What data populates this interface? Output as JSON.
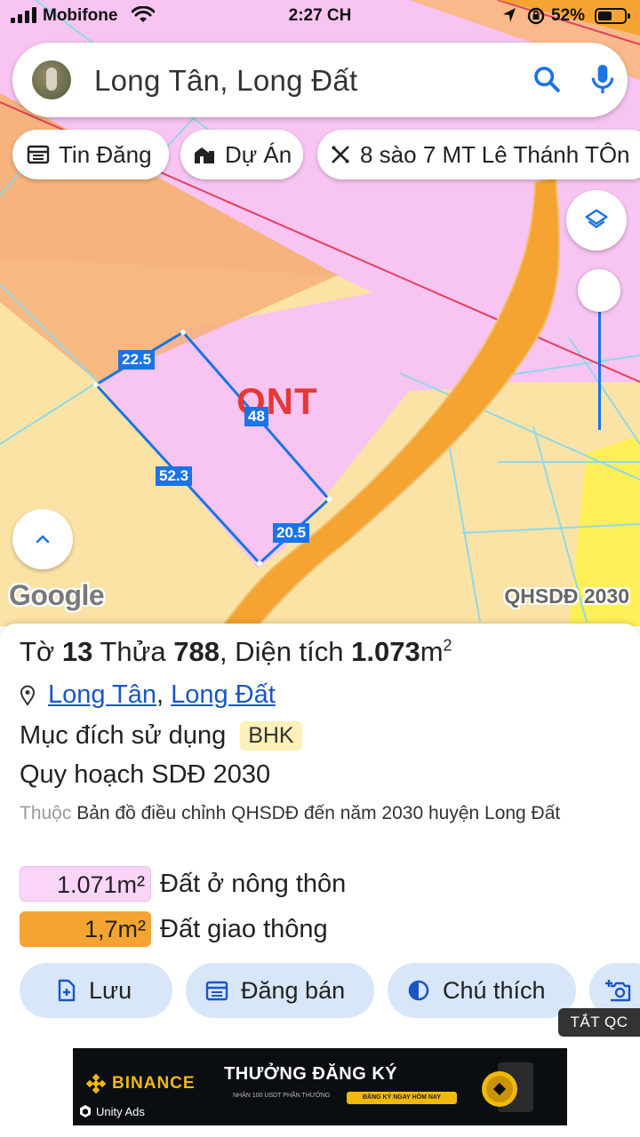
{
  "status_bar": {
    "carrier": "Mobifone",
    "time": "2:27 CH",
    "battery_percent": "52%",
    "battery_level": 0.52
  },
  "search": {
    "query": "Long Tân, Long Đất"
  },
  "chips": [
    {
      "label": "Tin Đăng",
      "icon": "newspaper-icon"
    },
    {
      "label": "Dự Án",
      "icon": "buildings-icon"
    },
    {
      "label": "8 sào 7 MT Lê Thánh TÔn",
      "icon": "pencil-ruler-icon"
    }
  ],
  "map": {
    "zone_label": "ONT",
    "dimensions": [
      "22.5",
      "48",
      "52.3",
      "20.5"
    ],
    "attribution": "Google",
    "layer_name": "QHSDĐ 2030",
    "colors": {
      "residential_rural": "#f8c4f2",
      "agricultural": "#fbe3a6",
      "transport": "#f5a431",
      "parcel_outline": "#1a73e8"
    }
  },
  "parcel": {
    "title_prefix": "Tờ ",
    "sheet_no": "13",
    "title_mid": " Thửa ",
    "parcel_no": "788",
    "title_area_label": ", Diện tích ",
    "area": "1.073",
    "area_unit": "m",
    "area_sup": "2",
    "location_ward": "Long Tân",
    "location_sep": ",",
    "location_district": "Long Đất",
    "purpose_label": "Mục đích sử dụng",
    "purpose_code": "BHK",
    "plan_label": "Quy hoạch SDĐ 2030",
    "source_prefix": "Thuộc",
    "source_text": " Bản đồ điều chỉnh QHSDĐ đến năm 2030 huyện Long Đất",
    "land_use": [
      {
        "area": "1.071m²",
        "name": "Đất ở nông thôn",
        "color": "#fbd5f7"
      },
      {
        "area": "1,7m²",
        "name": "Đất giao thông",
        "color": "#f5a431"
      }
    ]
  },
  "actions": [
    {
      "label": "Lưu",
      "icon": "add-document-icon"
    },
    {
      "label": "Đăng bán",
      "icon": "calendar-list-icon"
    },
    {
      "label": "Chú thích",
      "icon": "contrast-icon"
    },
    {
      "label": "",
      "icon": "add-photo-icon"
    }
  ],
  "ads": {
    "hide_label": "TẮT QC",
    "brand": "BINANCE",
    "headline": "THƯỞNG ĐĂNG KÝ",
    "sub": "NHẬN 100 USDT PHẦN THƯỞNG",
    "cta": "ĐĂNG KÝ NGAY HÔM NAY",
    "network": "Unity Ads"
  }
}
